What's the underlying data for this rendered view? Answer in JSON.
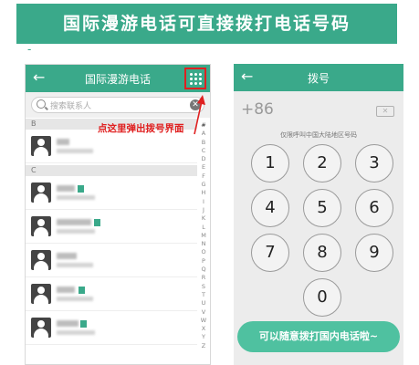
{
  "banner": {
    "text": "国际漫游电话可直接拨打电话号码",
    "dash": "-"
  },
  "left_screen": {
    "title": "国际漫游电话",
    "back_icon": "←",
    "search_placeholder": "搜索联系人",
    "clear_icon": "✕",
    "sections": [
      "B",
      "C"
    ],
    "annotation": "点这里弹出拨号界面",
    "index": [
      "#",
      "A",
      "B",
      "C",
      "D",
      "E",
      "F",
      "G",
      "H",
      "I",
      "J",
      "K",
      "L",
      "M",
      "N",
      "O",
      "P",
      "Q",
      "R",
      "S",
      "T",
      "U",
      "V",
      "W",
      "X",
      "Y",
      "Z"
    ]
  },
  "right_screen": {
    "title": "拨号",
    "back_icon": "←",
    "display": "+86",
    "backspace_icon": "✕",
    "hint": "仅限呼叫中国大陆地区号码",
    "keys": [
      "1",
      "2",
      "3",
      "4",
      "5",
      "6",
      "7",
      "8",
      "9",
      "0"
    ],
    "call_button": "可以随意拨打国内电话啦~"
  },
  "colors": {
    "accent": "#3aa98a",
    "annotation": "#e02020",
    "call": "#4fc1a0"
  }
}
